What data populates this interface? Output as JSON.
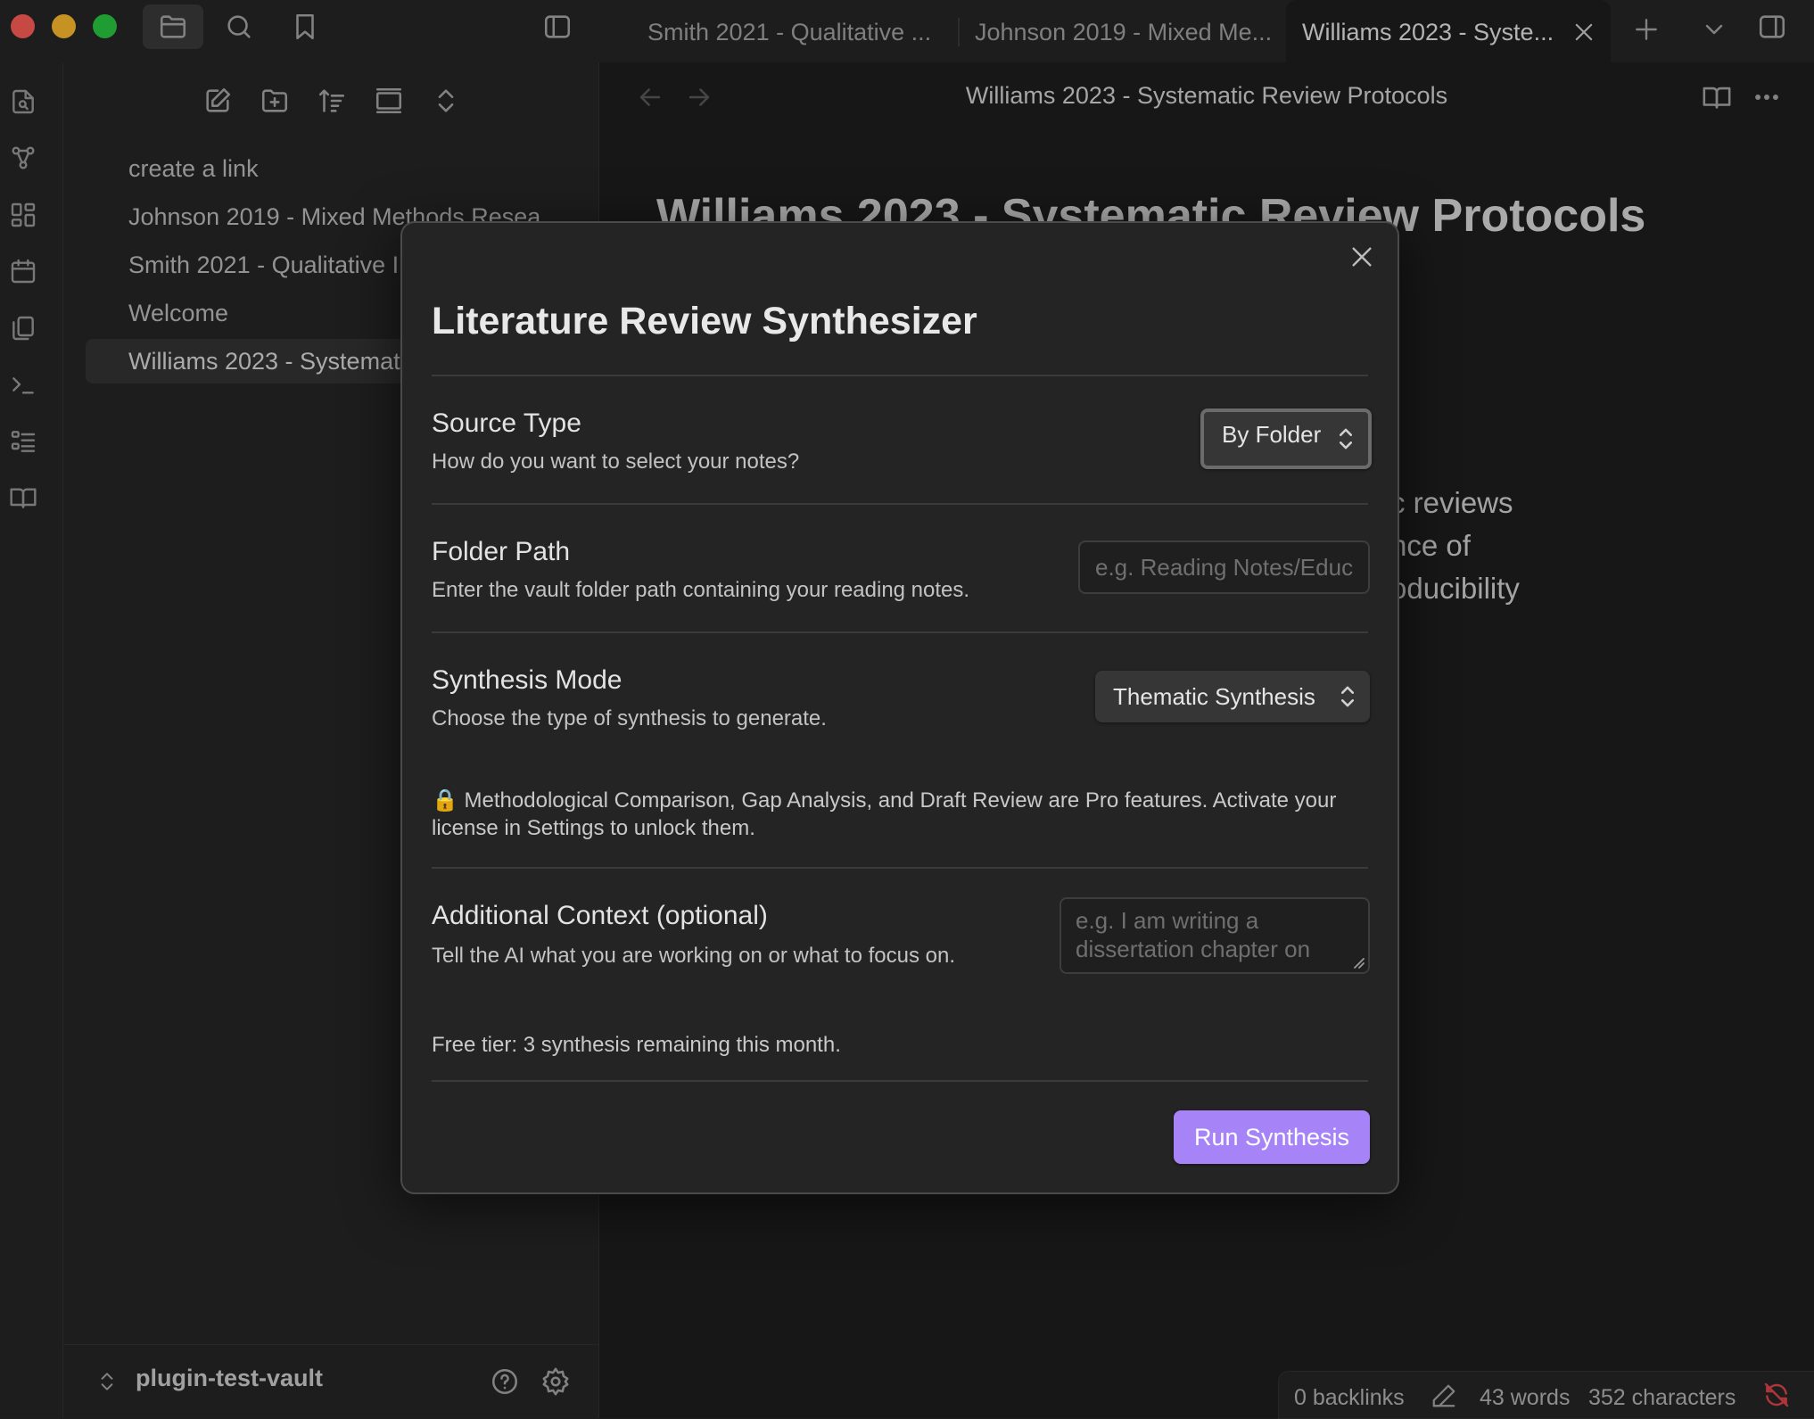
{
  "tabs": [
    {
      "label": "Smith 2021 - Qualitative ..."
    },
    {
      "label": "Johnson 2019 - Mixed Me..."
    },
    {
      "label": "Williams 2023 - Syste..."
    }
  ],
  "sidebar": {
    "files": [
      {
        "label": "create a link"
      },
      {
        "label": "Johnson 2019 - Mixed Methods Resea"
      },
      {
        "label": "Smith 2021 - Qualitative I"
      },
      {
        "label": "Welcome"
      },
      {
        "label": "Williams 2023 - Systemat"
      }
    ],
    "vault_name": "plugin-test-vault"
  },
  "editor": {
    "header_title": "Williams 2023 - Systematic Review Protocols",
    "heading": "Williams 2023 - Systematic Review Protocols",
    "body_fragments": [
      "c reviews",
      "nce of",
      "oducibility"
    ]
  },
  "status_bar": {
    "backlinks": "0 backlinks",
    "words": "43 words",
    "characters": "352 characters"
  },
  "modal": {
    "title": "Literature Review Synthesizer",
    "source_type": {
      "name": "Source Type",
      "desc": "How do you want to select your notes?",
      "value": "By Folder"
    },
    "folder_path": {
      "name": "Folder Path",
      "desc": "Enter the vault folder path containing your reading notes.",
      "placeholder": "e.g. Reading Notes/Educ"
    },
    "synthesis_mode": {
      "name": "Synthesis Mode",
      "desc": "Choose the type of synthesis to generate.",
      "value": "Thematic Synthesis"
    },
    "pro_note": "🔒 Methodological Comparison, Gap Analysis, and Draft Review are Pro features. Activate your license in Settings to unlock them.",
    "additional_context": {
      "name": "Additional Context (optional)",
      "desc": "Tell the AI what you are working on or what to focus on.",
      "placeholder": "e.g. I am writing a dissertation chapter on"
    },
    "free_tier": "Free tier: 3 synthesis remaining this month.",
    "run_button": "Run Synthesis"
  },
  "colors": {
    "accent": "#a684f8",
    "traffic_close": "#fe5f57",
    "traffic_min": "#febc2e",
    "traffic_max": "#28c840",
    "sync_error": "#e0454b"
  }
}
